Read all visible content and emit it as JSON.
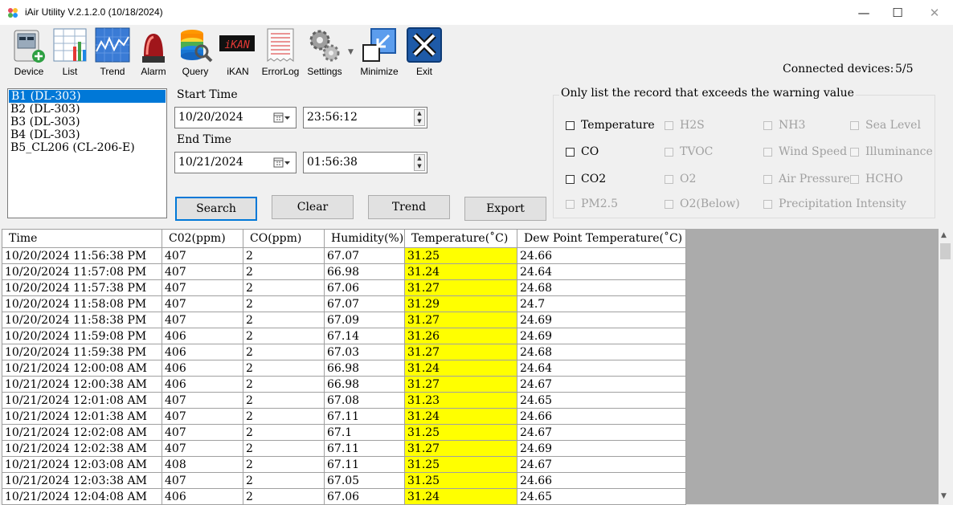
{
  "window": {
    "title": "iAir Utility V.2.1.2.0 (10/18/2024)"
  },
  "toolbar": {
    "device": "Device",
    "list": "List",
    "trend": "Trend",
    "alarm": "Alarm",
    "query": "Query",
    "ikan": "iKAN",
    "errorlog": "ErrorLog",
    "settings": "Settings",
    "minimize": "Minimize",
    "exit": "Exit",
    "ikan_sign": "iKAN"
  },
  "status": {
    "connected_label": "Connected devices:",
    "connected_value": "5/5"
  },
  "devices": [
    "B1 (DL-303)",
    "B2 (DL-303)",
    "B3 (DL-303)",
    "B4 (DL-303)",
    "B5_CL206 (CL-206-E)"
  ],
  "query": {
    "start_label": "Start Time",
    "start_date": "10/20/2024",
    "start_time": "23:56:12",
    "end_label": "End Time",
    "end_date": "10/21/2024",
    "end_time": "01:56:38"
  },
  "buttons": {
    "search": "Search",
    "clear": "Clear",
    "trend": "Trend",
    "export": "Export"
  },
  "warning": {
    "title": "Only list the record that exceeds the warning value",
    "items": [
      {
        "label": "Temperature",
        "enabled": true
      },
      {
        "label": "H2S",
        "enabled": false
      },
      {
        "label": "NH3",
        "enabled": false
      },
      {
        "label": "Sea Level",
        "enabled": false
      },
      {
        "label": "CO",
        "enabled": true
      },
      {
        "label": "TVOC",
        "enabled": false
      },
      {
        "label": "Wind Speed",
        "enabled": false
      },
      {
        "label": "Illuminance",
        "enabled": false
      },
      {
        "label": "CO2",
        "enabled": true
      },
      {
        "label": "O2",
        "enabled": false
      },
      {
        "label": "Air Pressure",
        "enabled": false
      },
      {
        "label": "HCHO",
        "enabled": false
      },
      {
        "label": "PM2.5",
        "enabled": false
      },
      {
        "label": "O2(Below)",
        "enabled": false
      },
      {
        "label": "Precipitation Intensity",
        "enabled": false
      }
    ]
  },
  "table": {
    "headers": [
      "Time",
      "C02(ppm)",
      "CO(ppm)",
      "Humidity(%)",
      "Temperature(˚C)",
      "Dew Point Temperature(˚C)"
    ],
    "highlight_color": "#ffff00",
    "rows": [
      [
        "10/20/2024 11:56:38 PM",
        "407",
        "2",
        "67.07",
        "31.25",
        "24.66"
      ],
      [
        "10/20/2024 11:57:08 PM",
        "407",
        "2",
        "66.98",
        "31.24",
        "24.64"
      ],
      [
        "10/20/2024 11:57:38 PM",
        "407",
        "2",
        "67.06",
        "31.27",
        "24.68"
      ],
      [
        "10/20/2024 11:58:08 PM",
        "407",
        "2",
        "67.07",
        "31.29",
        "24.7"
      ],
      [
        "10/20/2024 11:58:38 PM",
        "407",
        "2",
        "67.09",
        "31.27",
        "24.69"
      ],
      [
        "10/20/2024 11:59:08 PM",
        "406",
        "2",
        "67.14",
        "31.26",
        "24.69"
      ],
      [
        "10/20/2024 11:59:38 PM",
        "406",
        "2",
        "67.03",
        "31.27",
        "24.68"
      ],
      [
        "10/21/2024 12:00:08 AM",
        "406",
        "2",
        "66.98",
        "31.24",
        "24.64"
      ],
      [
        "10/21/2024 12:00:38 AM",
        "406",
        "2",
        "66.98",
        "31.27",
        "24.67"
      ],
      [
        "10/21/2024 12:01:08 AM",
        "407",
        "2",
        "67.08",
        "31.23",
        "24.65"
      ],
      [
        "10/21/2024 12:01:38 AM",
        "407",
        "2",
        "67.11",
        "31.24",
        "24.66"
      ],
      [
        "10/21/2024 12:02:08 AM",
        "407",
        "2",
        "67.1",
        "31.25",
        "24.67"
      ],
      [
        "10/21/2024 12:02:38 AM",
        "407",
        "2",
        "67.11",
        "31.27",
        "24.69"
      ],
      [
        "10/21/2024 12:03:08 AM",
        "408",
        "2",
        "67.11",
        "31.25",
        "24.67"
      ],
      [
        "10/21/2024 12:03:38 AM",
        "407",
        "2",
        "67.05",
        "31.25",
        "24.66"
      ],
      [
        "10/21/2024 12:04:08 AM",
        "406",
        "2",
        "67.06",
        "31.24",
        "24.65"
      ]
    ]
  }
}
